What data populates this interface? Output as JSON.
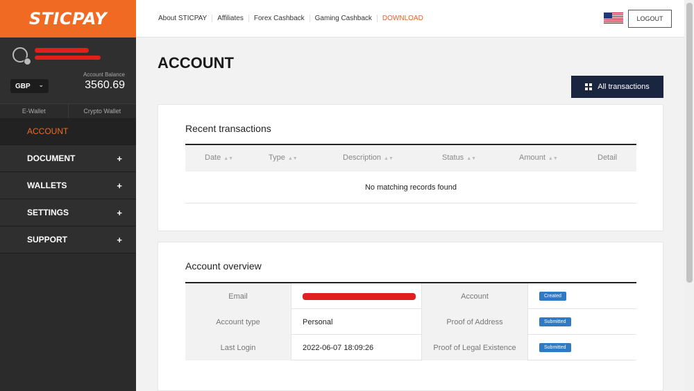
{
  "brand": {
    "logo": "STICPAY",
    "accent": "#f06a24"
  },
  "sidebar": {
    "balance_label": "Account Balance",
    "balance": "3560.69",
    "currency": "GBP",
    "wallet_tabs": [
      "E-Wallet",
      "Crypto Wallet"
    ],
    "nav": [
      {
        "label": "ACCOUNT",
        "active": true,
        "expand": ""
      },
      {
        "label": "DOCUMENT",
        "active": false,
        "expand": "+"
      },
      {
        "label": "WALLETS",
        "active": false,
        "expand": "+"
      },
      {
        "label": "SETTINGS",
        "active": false,
        "expand": "+"
      },
      {
        "label": "SUPPORT",
        "active": false,
        "expand": "+"
      }
    ]
  },
  "topbar": {
    "links": [
      "About STICPAY",
      "Affiliates",
      "Forex Cashback",
      "Gaming Cashback",
      "DOWNLOAD"
    ],
    "logout": "LOGOUT",
    "flag_icon": "us-flag-icon"
  },
  "main": {
    "title": "ACCOUNT",
    "all_transactions": "All transactions",
    "recent": {
      "title": "Recent transactions",
      "columns": [
        "Date",
        "Type",
        "Description",
        "Status",
        "Amount",
        "Detail"
      ],
      "empty": "No matching records found"
    },
    "overview": {
      "title": "Account overview",
      "rows": [
        {
          "label1": "Email",
          "value1": "",
          "label2": "Account",
          "badge": "Created"
        },
        {
          "label1": "Account type",
          "value1": "Personal",
          "label2": "Proof of Address",
          "badge": "Submitted"
        },
        {
          "label1": "Last Login",
          "value1": "2022-06-07 18:09:26",
          "label2": "Proof of Legal Existence",
          "badge": "Submitted"
        }
      ]
    }
  }
}
